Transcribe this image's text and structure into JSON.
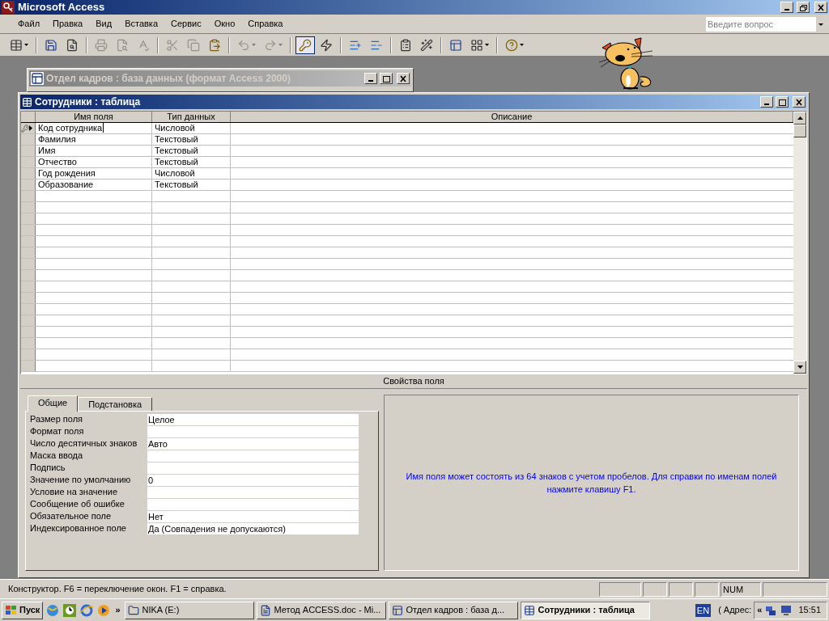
{
  "app_window": {
    "title": "Microsoft Access"
  },
  "menu": [
    "Файл",
    "Правка",
    "Вид",
    "Вставка",
    "Сервис",
    "Окно",
    "Справка"
  ],
  "help_search": {
    "placeholder": "Введите вопрос"
  },
  "toolbar": [
    {
      "kind": "button",
      "disabled": false,
      "pressed": false,
      "dropdown": true
    },
    {
      "kind": "separator"
    },
    {
      "kind": "button",
      "disabled": false,
      "pressed": false,
      "dropdown": false
    },
    {
      "kind": "button",
      "disabled": false,
      "pressed": false,
      "dropdown": false
    },
    {
      "kind": "separator"
    },
    {
      "kind": "button",
      "disabled": true,
      "pressed": false,
      "dropdown": false
    },
    {
      "kind": "button",
      "disabled": true,
      "pressed": false,
      "dropdown": false
    },
    {
      "kind": "button",
      "disabled": true,
      "pressed": false,
      "dropdown": false
    },
    {
      "kind": "separator"
    },
    {
      "kind": "button",
      "disabled": true,
      "pressed": false,
      "dropdown": false
    },
    {
      "kind": "button",
      "disabled": true,
      "pressed": false,
      "dropdown": false
    },
    {
      "kind": "button",
      "disabled": false,
      "pressed": false,
      "dropdown": false
    },
    {
      "kind": "separator"
    },
    {
      "kind": "button",
      "disabled": true,
      "pressed": false,
      "dropdown": true
    },
    {
      "kind": "button",
      "disabled": true,
      "pressed": false,
      "dropdown": true
    },
    {
      "kind": "separator"
    },
    {
      "kind": "button",
      "disabled": false,
      "pressed": true,
      "dropdown": false
    },
    {
      "kind": "button",
      "disabled": false,
      "pressed": false,
      "dropdown": false
    },
    {
      "kind": "separator"
    },
    {
      "kind": "button",
      "disabled": false,
      "pressed": false,
      "dropdown": false
    },
    {
      "kind": "button",
      "disabled": false,
      "pressed": false,
      "dropdown": false
    },
    {
      "kind": "separator"
    },
    {
      "kind": "button",
      "disabled": false,
      "pressed": false,
      "dropdown": false
    },
    {
      "kind": "button",
      "disabled": false,
      "pressed": false,
      "dropdown": false
    },
    {
      "kind": "separator"
    },
    {
      "kind": "button",
      "disabled": false,
      "pressed": false,
      "dropdown": false
    },
    {
      "kind": "button",
      "disabled": false,
      "pressed": false,
      "dropdown": true
    },
    {
      "kind": "separator"
    },
    {
      "kind": "button",
      "disabled": false,
      "pressed": false,
      "dropdown": true
    }
  ],
  "database_window": {
    "title": "Отдел кадров : база данных (формат Access 2000)",
    "active": false
  },
  "table_window": {
    "title": "Сотрудники : таблица",
    "active": true,
    "columns": [
      "Имя поля",
      "Тип данных",
      "Описание"
    ],
    "rows": [
      {
        "name": "Код сотрудника",
        "type": "Числовой",
        "primary_key": true,
        "selected": true
      },
      {
        "name": "Фамилия",
        "type": "Текстовый",
        "primary_key": false,
        "selected": false
      },
      {
        "name": "Имя",
        "type": "Текстовый",
        "primary_key": false,
        "selected": false
      },
      {
        "name": "Отчество",
        "type": "Текстовый",
        "primary_key": false,
        "selected": false
      },
      {
        "name": "Год рождения",
        "type": "Числовой",
        "primary_key": false,
        "selected": false
      },
      {
        "name": "Образование",
        "type": "Текстовый",
        "primary_key": false,
        "selected": false
      }
    ],
    "properties_title": "Свойства поля",
    "tabs": [
      {
        "label": "Общие",
        "selected": true
      },
      {
        "label": "Подстановка",
        "selected": false
      }
    ],
    "properties": [
      {
        "label": "Размер поля",
        "value": "Целое"
      },
      {
        "label": "Формат поля"
      },
      {
        "label": "Число десятичных знаков",
        "value": "Авто"
      },
      {
        "label": "Маска ввода"
      },
      {
        "label": "Подпись"
      },
      {
        "label": "Значение по умолчанию",
        "value": "0"
      },
      {
        "label": "Условие на значение"
      },
      {
        "label": "Сообщение об ошибке"
      },
      {
        "label": "Обязательное поле",
        "value": "Нет"
      },
      {
        "label": "Индексированное поле",
        "value": "Да (Совпадения не допускаются)"
      }
    ],
    "help_text": "Имя поля может состоять из 64 знаков с учетом пробелов.  Для справки по именам полей нажмите клавишу F1."
  },
  "status_bar": {
    "message": "Конструктор.  F6 = переключение окон.  F1 = справка.",
    "indicator": "NUM"
  },
  "taskbar": {
    "start": "Пуск",
    "more": "»",
    "tasks": [
      {
        "label": "NIKA (E:)",
        "selected": false
      },
      {
        "label": "Метод ACCESS.doc - Mi...",
        "selected": false
      },
      {
        "label": "Отдел кадров : база д...",
        "selected": false
      },
      {
        "label": "Сотрудники : таблица",
        "selected": true
      }
    ],
    "language": "EN",
    "toolbar_edge": "(",
    "address_label": "Адрес:",
    "expand": "«",
    "clock": "15:51"
  }
}
